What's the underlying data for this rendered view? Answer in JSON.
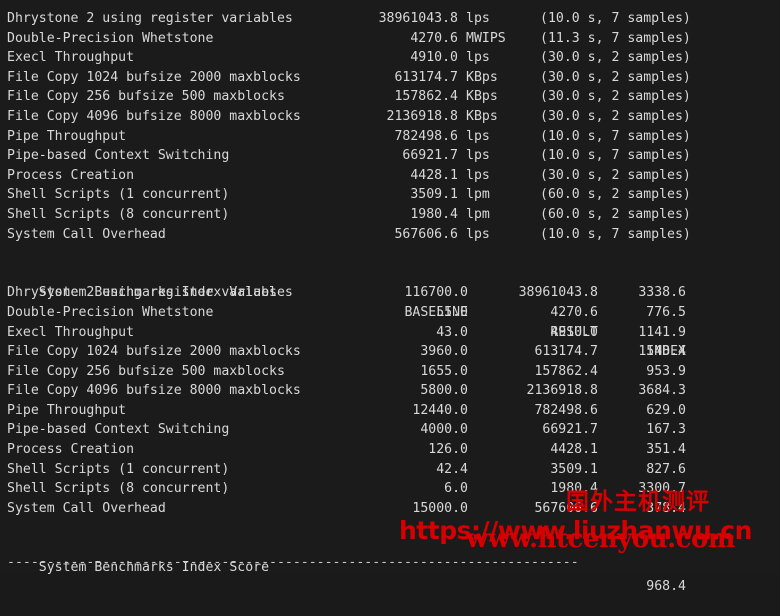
{
  "terminal": {
    "benchmark_results": {
      "rows": [
        {
          "name": "Dhrystone 2 using register variables",
          "value": "38961043.8",
          "unit": "lps",
          "samples": "(10.0 s, 7 samples)"
        },
        {
          "name": "Double-Precision Whetstone",
          "value": "4270.6",
          "unit": "MWIPS",
          "samples": "(11.3 s, 7 samples)"
        },
        {
          "name": "Execl Throughput",
          "value": "4910.0",
          "unit": "lps",
          "samples": "(30.0 s, 2 samples)"
        },
        {
          "name": "File Copy 1024 bufsize 2000 maxblocks",
          "value": "613174.7",
          "unit": "KBps",
          "samples": "(30.0 s, 2 samples)"
        },
        {
          "name": "File Copy 256 bufsize 500 maxblocks",
          "value": "157862.4",
          "unit": "KBps",
          "samples": "(30.0 s, 2 samples)"
        },
        {
          "name": "File Copy 4096 bufsize 8000 maxblocks",
          "value": "2136918.8",
          "unit": "KBps",
          "samples": "(30.0 s, 2 samples)"
        },
        {
          "name": "Pipe Throughput",
          "value": "782498.6",
          "unit": "lps",
          "samples": "(10.0 s, 7 samples)"
        },
        {
          "name": "Pipe-based Context Switching",
          "value": "66921.7",
          "unit": "lps",
          "samples": "(10.0 s, 7 samples)"
        },
        {
          "name": "Process Creation",
          "value": "4428.1",
          "unit": "lps",
          "samples": "(30.0 s, 2 samples)"
        },
        {
          "name": "Shell Scripts (1 concurrent)",
          "value": "3509.1",
          "unit": "lpm",
          "samples": "(60.0 s, 2 samples)"
        },
        {
          "name": "Shell Scripts (8 concurrent)",
          "value": "1980.4",
          "unit": "lpm",
          "samples": "(60.0 s, 2 samples)"
        },
        {
          "name": "System Call Overhead",
          "value": "567606.6",
          "unit": "lps",
          "samples": "(10.0 s, 7 samples)"
        }
      ]
    },
    "index_values": {
      "title": "System Benchmarks Index Values",
      "columns": {
        "baseline": "BASELINE",
        "result": "RESULT",
        "index": "INDEX"
      },
      "rows": [
        {
          "name": "Dhrystone 2 using register variables",
          "baseline": "116700.0",
          "result": "38961043.8",
          "index": "3338.6"
        },
        {
          "name": "Double-Precision Whetstone",
          "baseline": "55.0",
          "result": "4270.6",
          "index": "776.5"
        },
        {
          "name": "Execl Throughput",
          "baseline": "43.0",
          "result": "4910.0",
          "index": "1141.9"
        },
        {
          "name": "File Copy 1024 bufsize 2000 maxblocks",
          "baseline": "3960.0",
          "result": "613174.7",
          "index": "1548.4"
        },
        {
          "name": "File Copy 256 bufsize 500 maxblocks",
          "baseline": "1655.0",
          "result": "157862.4",
          "index": "953.9"
        },
        {
          "name": "File Copy 4096 bufsize 8000 maxblocks",
          "baseline": "5800.0",
          "result": "2136918.8",
          "index": "3684.3"
        },
        {
          "name": "Pipe Throughput",
          "baseline": "12440.0",
          "result": "782498.6",
          "index": "629.0"
        },
        {
          "name": "Pipe-based Context Switching",
          "baseline": "4000.0",
          "result": "66921.7",
          "index": "167.3"
        },
        {
          "name": "Process Creation",
          "baseline": "126.0",
          "result": "4428.1",
          "index": "351.4"
        },
        {
          "name": "Shell Scripts (1 concurrent)",
          "baseline": "42.4",
          "result": "3509.1",
          "index": "827.6"
        },
        {
          "name": "Shell Scripts (8 concurrent)",
          "baseline": "6.0",
          "result": "1980.4",
          "index": "3300.7"
        },
        {
          "name": "System Call Overhead",
          "baseline": "15000.0",
          "result": "567606.6",
          "index": "378.4"
        }
      ]
    },
    "score": {
      "label": "System Benchmarks Index Score",
      "value": "968.4"
    },
    "separator": "------------------------------------------------------------------------"
  },
  "watermarks": {
    "chinese": "国外主机测评",
    "url_primary": "https://www.liuzhanwu.cn",
    "url_secondary": "www.htcenyou.com",
    "color": "#d70000"
  },
  "colors": {
    "background": "#1b1b1b",
    "text": "#d8d8d8"
  }
}
